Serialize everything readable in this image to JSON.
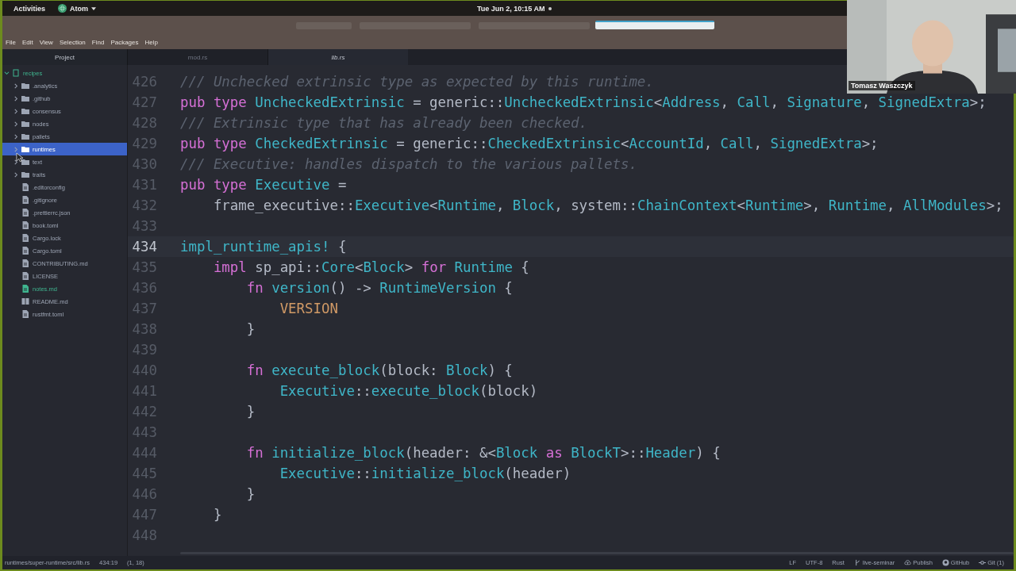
{
  "top_bar": {
    "activities": "Activities",
    "app": "Atom",
    "clock": "Tue Jun 2, 10:15 AM"
  },
  "menu": [
    "File",
    "Edit",
    "View",
    "Selection",
    "Find",
    "Packages",
    "Help"
  ],
  "tabs": [
    {
      "label": "Project",
      "kind": "panel",
      "selected": false
    },
    {
      "label": "mod.rs",
      "kind": "file",
      "selected": false
    },
    {
      "label": "lib.rs",
      "kind": "file",
      "selected": true
    }
  ],
  "tree": {
    "label": "recipes",
    "expanded": true,
    "children": [
      {
        "label": ".analytics",
        "kind": "folder",
        "expanded": false,
        "selected": false
      },
      {
        "label": ".github",
        "kind": "folder",
        "expanded": false,
        "selected": false
      },
      {
        "label": "consensus",
        "kind": "folder",
        "expanded": false,
        "selected": false
      },
      {
        "label": "nodes",
        "kind": "folder",
        "expanded": false,
        "selected": false
      },
      {
        "label": "pallets",
        "kind": "folder",
        "expanded": false,
        "selected": false
      },
      {
        "label": "runtimes",
        "kind": "folder",
        "expanded": false,
        "selected": true
      },
      {
        "label": "text",
        "kind": "folder",
        "expanded": false,
        "selected": false
      },
      {
        "label": "traits",
        "kind": "folder",
        "expanded": false,
        "selected": false
      },
      {
        "label": ".editorconfig",
        "kind": "file",
        "selected": false,
        "color": "#9da5b4"
      },
      {
        "label": ".gitignore",
        "kind": "file",
        "selected": false,
        "color": "#9da5b4"
      },
      {
        "label": ".prettierrc.json",
        "kind": "file",
        "selected": false,
        "color": "#9da5b4"
      },
      {
        "label": "book.toml",
        "kind": "file",
        "selected": false,
        "color": "#9da5b4"
      },
      {
        "label": "Cargo.lock",
        "kind": "file",
        "selected": false,
        "color": "#9da5b4"
      },
      {
        "label": "Cargo.toml",
        "kind": "file",
        "selected": false,
        "color": "#9da5b4"
      },
      {
        "label": "CONTRIBUTING.md",
        "kind": "file",
        "selected": false,
        "color": "#9da5b4"
      },
      {
        "label": "LICENSE",
        "kind": "file",
        "selected": false,
        "color": "#9da5b4"
      },
      {
        "label": "notes.md",
        "kind": "file",
        "selected": false,
        "color": "#3fb58f"
      },
      {
        "label": "README.md",
        "kind": "book",
        "selected": false,
        "color": "#9da5b4"
      },
      {
        "label": "rustfmt.toml",
        "kind": "file",
        "selected": false,
        "color": "#9da5b4"
      }
    ]
  },
  "code_lines": [
    {
      "number": "426",
      "current": false,
      "tokens": [
        {
          "kind": "cm",
          "text": "/// Unchecked extrinsic type as expected by this runtime."
        }
      ]
    },
    {
      "number": "427",
      "current": false,
      "tokens": [
        {
          "kind": "kw",
          "text": "pub type "
        },
        {
          "kind": "ty",
          "text": "UncheckedExtrinsic"
        },
        {
          "kind": "p",
          "text": " = generic::"
        },
        {
          "kind": "ty",
          "text": "UncheckedExtrinsic"
        },
        {
          "kind": "p",
          "text": "<"
        },
        {
          "kind": "ty",
          "text": "Address"
        },
        {
          "kind": "p",
          "text": ", "
        },
        {
          "kind": "ty",
          "text": "Call"
        },
        {
          "kind": "p",
          "text": ", "
        },
        {
          "kind": "ty",
          "text": "Signature"
        },
        {
          "kind": "p",
          "text": ", "
        },
        {
          "kind": "ty",
          "text": "SignedExtra"
        },
        {
          "kind": "p",
          "text": ">;"
        }
      ]
    },
    {
      "number": "428",
      "current": false,
      "tokens": [
        {
          "kind": "cm",
          "text": "/// Extrinsic type that has already been checked."
        }
      ]
    },
    {
      "number": "429",
      "current": false,
      "tokens": [
        {
          "kind": "kw",
          "text": "pub type "
        },
        {
          "kind": "ty",
          "text": "CheckedExtrinsic"
        },
        {
          "kind": "p",
          "text": " = generic::"
        },
        {
          "kind": "ty",
          "text": "CheckedExtrinsic"
        },
        {
          "kind": "p",
          "text": "<"
        },
        {
          "kind": "ty",
          "text": "AccountId"
        },
        {
          "kind": "p",
          "text": ", "
        },
        {
          "kind": "ty",
          "text": "Call"
        },
        {
          "kind": "p",
          "text": ", "
        },
        {
          "kind": "ty",
          "text": "SignedExtra"
        },
        {
          "kind": "p",
          "text": ">;"
        }
      ]
    },
    {
      "number": "430",
      "current": false,
      "tokens": [
        {
          "kind": "cm",
          "text": "/// Executive: handles dispatch to the various pallets."
        }
      ]
    },
    {
      "number": "431",
      "current": false,
      "tokens": [
        {
          "kind": "kw",
          "text": "pub type "
        },
        {
          "kind": "ty",
          "text": "Executive"
        },
        {
          "kind": "p",
          "text": " ="
        }
      ]
    },
    {
      "number": "432",
      "current": false,
      "tokens": [
        {
          "kind": "p",
          "text": "    frame_executive::"
        },
        {
          "kind": "ty",
          "text": "Executive"
        },
        {
          "kind": "p",
          "text": "<"
        },
        {
          "kind": "ty",
          "text": "Runtime"
        },
        {
          "kind": "p",
          "text": ", "
        },
        {
          "kind": "ty",
          "text": "Block"
        },
        {
          "kind": "p",
          "text": ", system::"
        },
        {
          "kind": "ty",
          "text": "ChainContext"
        },
        {
          "kind": "p",
          "text": "<"
        },
        {
          "kind": "ty",
          "text": "Runtime"
        },
        {
          "kind": "p",
          "text": ">, "
        },
        {
          "kind": "ty",
          "text": "Runtime"
        },
        {
          "kind": "p",
          "text": ", "
        },
        {
          "kind": "ty",
          "text": "AllModules"
        },
        {
          "kind": "p",
          "text": ">;"
        }
      ]
    },
    {
      "number": "433",
      "current": false
    },
    {
      "number": "434",
      "current": true,
      "tokens": [
        {
          "kind": "mac",
          "text": "impl_runtime_apis!"
        },
        {
          "kind": "p",
          "text": " {"
        }
      ]
    },
    {
      "number": "435",
      "current": false,
      "tokens": [
        {
          "kind": "kw",
          "text": "    impl "
        },
        {
          "kind": "p",
          "text": "sp_api::"
        },
        {
          "kind": "ty",
          "text": "Core"
        },
        {
          "kind": "p",
          "text": "<"
        },
        {
          "kind": "ty",
          "text": "Block"
        },
        {
          "kind": "p",
          "text": "> "
        },
        {
          "kind": "kw",
          "text": "for "
        },
        {
          "kind": "ty",
          "text": "Runtime"
        },
        {
          "kind": "p",
          "text": " {"
        }
      ]
    },
    {
      "number": "436",
      "current": false,
      "tokens": [
        {
          "kind": "kw",
          "text": "        fn "
        },
        {
          "kind": "fn",
          "text": "version"
        },
        {
          "kind": "p",
          "text": "() -> "
        },
        {
          "kind": "ty",
          "text": "RuntimeVersion"
        },
        {
          "kind": "p",
          "text": " {"
        }
      ]
    },
    {
      "number": "437",
      "current": false,
      "tokens": [
        {
          "kind": "const",
          "text": "            VERSION"
        }
      ]
    },
    {
      "number": "438",
      "current": false,
      "tokens": [
        {
          "kind": "p",
          "text": "        }"
        }
      ]
    },
    {
      "number": "439",
      "current": false
    },
    {
      "number": "440",
      "current": false,
      "tokens": [
        {
          "kind": "kw",
          "text": "        fn "
        },
        {
          "kind": "fn",
          "text": "execute_block"
        },
        {
          "kind": "p",
          "text": "(block: "
        },
        {
          "kind": "ty",
          "text": "Block"
        },
        {
          "kind": "p",
          "text": ") {"
        }
      ]
    },
    {
      "number": "441",
      "current": false,
      "tokens": [
        {
          "kind": "ty",
          "text": "            Executive"
        },
        {
          "kind": "p",
          "text": "::"
        },
        {
          "kind": "fn",
          "text": "execute_block"
        },
        {
          "kind": "p",
          "text": "(block)"
        }
      ]
    },
    {
      "number": "442",
      "current": false,
      "tokens": [
        {
          "kind": "p",
          "text": "        }"
        }
      ]
    },
    {
      "number": "443",
      "current": false
    },
    {
      "number": "444",
      "current": false,
      "tokens": [
        {
          "kind": "kw",
          "text": "        fn "
        },
        {
          "kind": "fn",
          "text": "initialize_block"
        },
        {
          "kind": "p",
          "text": "(header: &<"
        },
        {
          "kind": "ty",
          "text": "Block"
        },
        {
          "kind": "kw",
          "text": " as "
        },
        {
          "kind": "ty",
          "text": "BlockT"
        },
        {
          "kind": "p",
          "text": ">::"
        },
        {
          "kind": "ty",
          "text": "Header"
        },
        {
          "kind": "p",
          "text": ") {"
        }
      ]
    },
    {
      "number": "445",
      "current": false,
      "tokens": [
        {
          "kind": "ty",
          "text": "            Executive"
        },
        {
          "kind": "p",
          "text": "::"
        },
        {
          "kind": "fn",
          "text": "initialize_block"
        },
        {
          "kind": "p",
          "text": "(header)"
        }
      ]
    },
    {
      "number": "446",
      "current": false,
      "tokens": [
        {
          "kind": "p",
          "text": "        }"
        }
      ]
    },
    {
      "number": "447",
      "current": false,
      "tokens": [
        {
          "kind": "p",
          "text": "    }"
        }
      ]
    },
    {
      "number": "448",
      "current": false
    }
  ],
  "status_bar": {
    "path": "runtimes/super-runtime/src/lib.rs",
    "cursor": "434:19",
    "selection": "(1, 18)",
    "right": [
      {
        "label": "LF",
        "kind": "text"
      },
      {
        "label": "UTF-8",
        "kind": "text"
      },
      {
        "label": "Rust",
        "kind": "text"
      },
      {
        "label": "live-seminar",
        "kind": "branch"
      },
      {
        "label": "Publish",
        "kind": "cloud"
      },
      {
        "label": "GitHub",
        "kind": "github"
      },
      {
        "label": "Git (1)",
        "kind": "git"
      }
    ]
  },
  "webcam": {
    "kind": "picture",
    "name": "Tomasz Waszczyk"
  }
}
